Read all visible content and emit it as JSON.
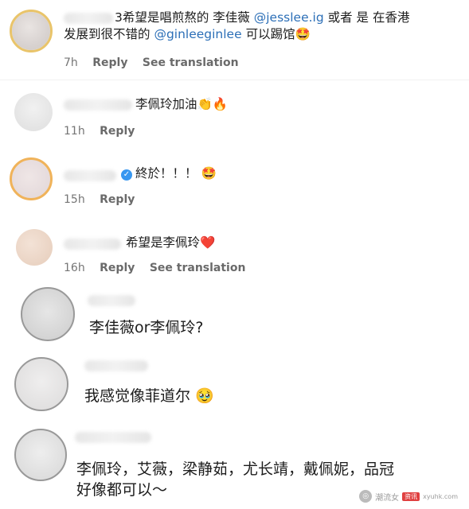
{
  "comments": [
    {
      "name_tail": "3",
      "text_a": "希望是唱煎熬的 李佳薇 ",
      "mention_1": "@jesslee.ig",
      "text_b": " 或者 是 在香港",
      "text_c": "发展到很不错的 ",
      "mention_2": "@ginleeginlee",
      "text_d": " 可以踢馆",
      "emoji": "🤩",
      "time": "7h",
      "reply": "Reply",
      "see_translation": "See translation"
    },
    {
      "text": "李佩玲加油",
      "emoji": "👏🔥",
      "time": "11h",
      "reply": "Reply"
    },
    {
      "verified_icon": "check",
      "text": "終於！！！",
      "emoji": "🤩",
      "time": "15h",
      "reply": "Reply"
    },
    {
      "text": "希望是李佩玲",
      "emoji": "❤️",
      "time": "16h",
      "reply": "Reply",
      "see_translation": "See translation"
    },
    {
      "text": "李佳薇or李佩玲?"
    },
    {
      "text": "我感觉像菲道尔",
      "emoji": "🥹"
    },
    {
      "line1": "李佩玲，艾薇，梁静茹，尤长靖，戴佩妮，品冠",
      "line2": "好像都可以～"
    }
  ],
  "watermark": {
    "text": "潮流女",
    "badge": "资讯",
    "url": "xyuhk.com"
  },
  "colors": {
    "mention": "#2c6fb7",
    "meta": "#757575",
    "verified": "#3897f0"
  }
}
